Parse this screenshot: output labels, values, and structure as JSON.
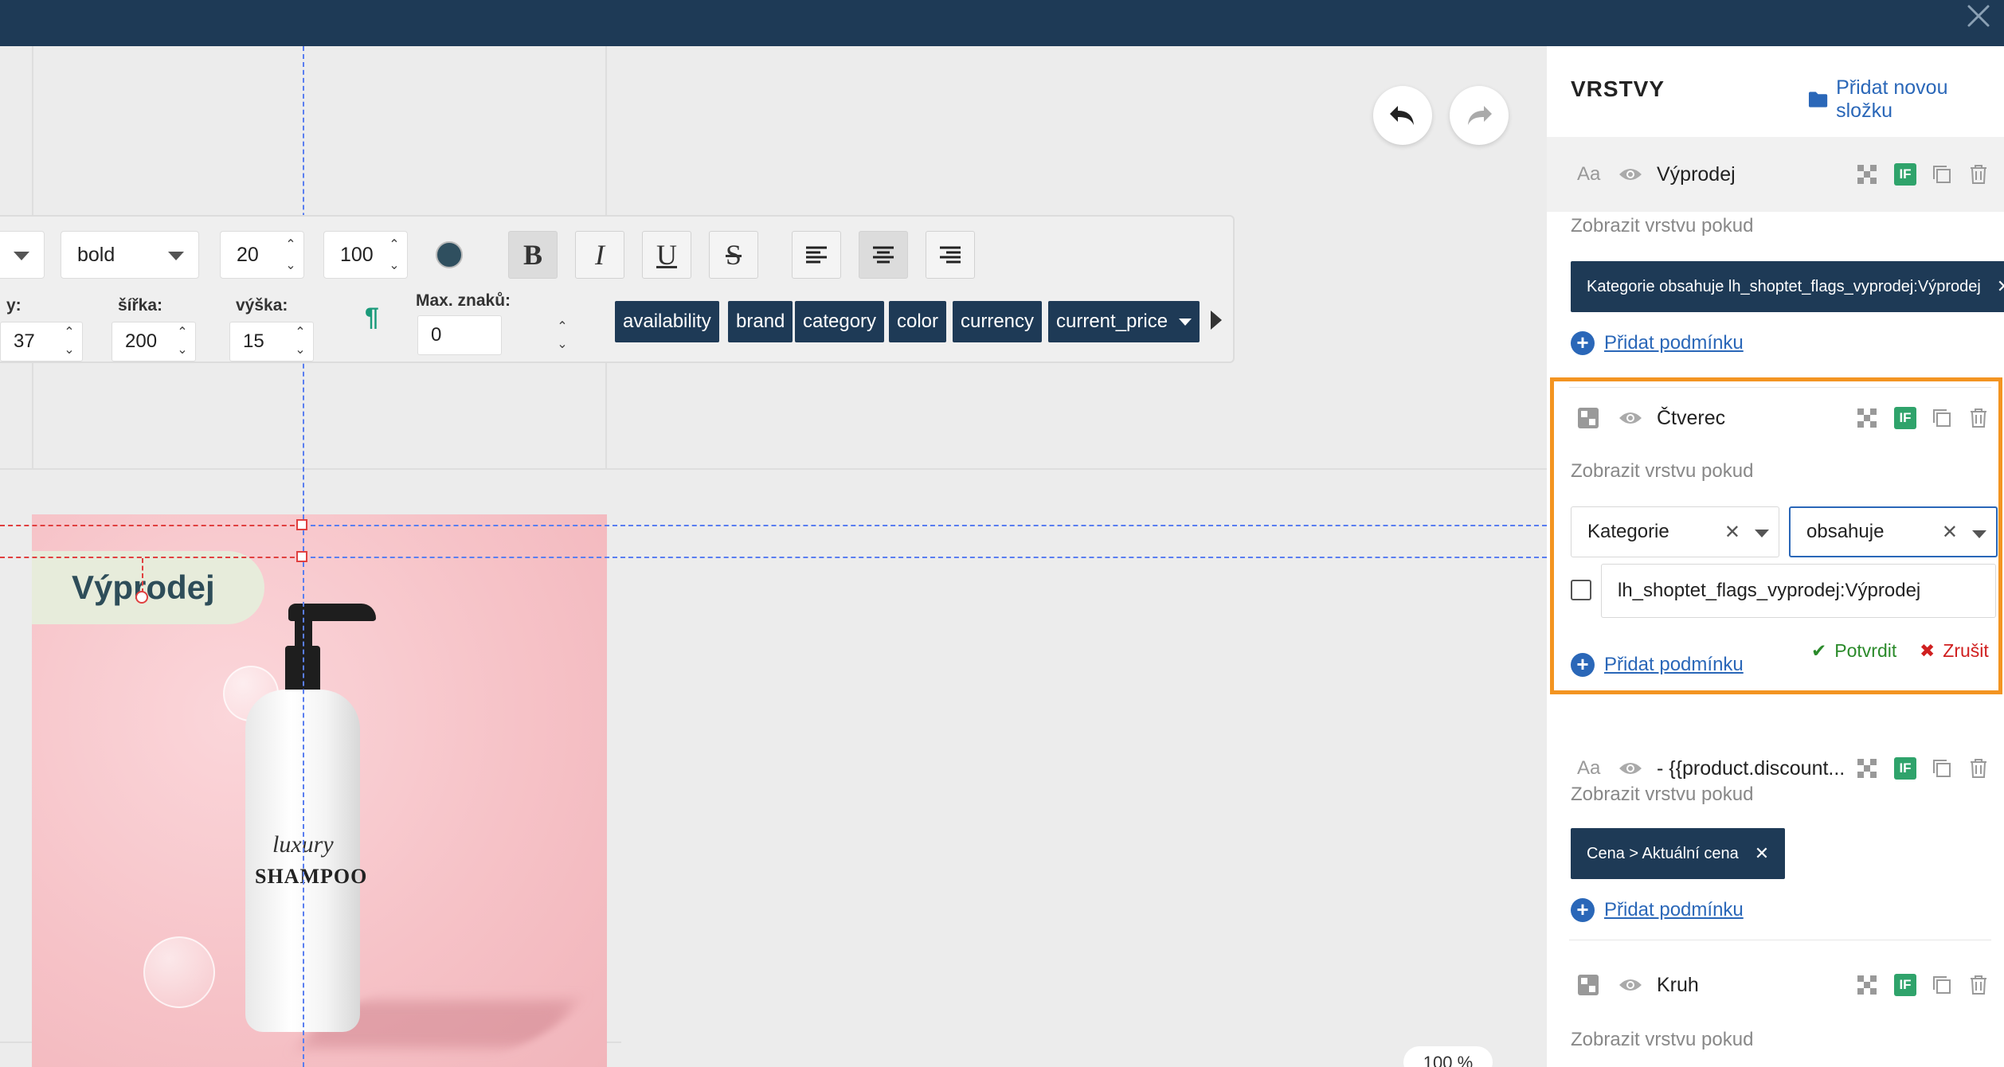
{
  "toolbar": {
    "font_weight": "bold",
    "font_size": "20",
    "line_height": "100",
    "labels": {
      "y": "y:",
      "width": "šířka:",
      "height": "výška:",
      "max_chars": "Max. znaků:"
    },
    "y_value": "37",
    "width_value": "200",
    "height_value": "15",
    "max_chars_value": "0",
    "text_color": "#2f4f5f",
    "variables": [
      "availability",
      "brand",
      "category",
      "color",
      "currency",
      "current_price"
    ]
  },
  "canvas": {
    "badge_text": "Výprodej",
    "bottle_script": "luxury",
    "bottle_name": "SHAMPOO",
    "zoom": "100 %"
  },
  "panel": {
    "title": "VRSTVY",
    "add_folder": "Přidat novou složku",
    "show_if": "Zobrazit vrstvu pokud",
    "add_condition": "Přidat podmínku",
    "layers": [
      {
        "name": "Výprodej",
        "type": "text",
        "type_label": "Aa",
        "condition": "Kategorie obsahuje lh_shoptet_flags_vyprodej:Výprodej"
      },
      {
        "name": "Čtverec",
        "type": "shape"
      },
      {
        "name": "- {{product.discount...",
        "type": "text",
        "type_label": "Aa",
        "condition": "Cena > Aktuální cena"
      },
      {
        "name": "Kruh",
        "type": "shape"
      }
    ],
    "if_label": "IF",
    "editor": {
      "field": "Kategorie",
      "operator": "obsahuje",
      "value": "lh_shoptet_flags_vyprodej:Výprodej",
      "confirm": "Potvrdit",
      "cancel": "Zrušit"
    }
  },
  "colors": {
    "topbar": "#1e3a56",
    "accent": "#2a67b8",
    "highlight": "#f39421",
    "if_badge": "#2fa36b"
  }
}
